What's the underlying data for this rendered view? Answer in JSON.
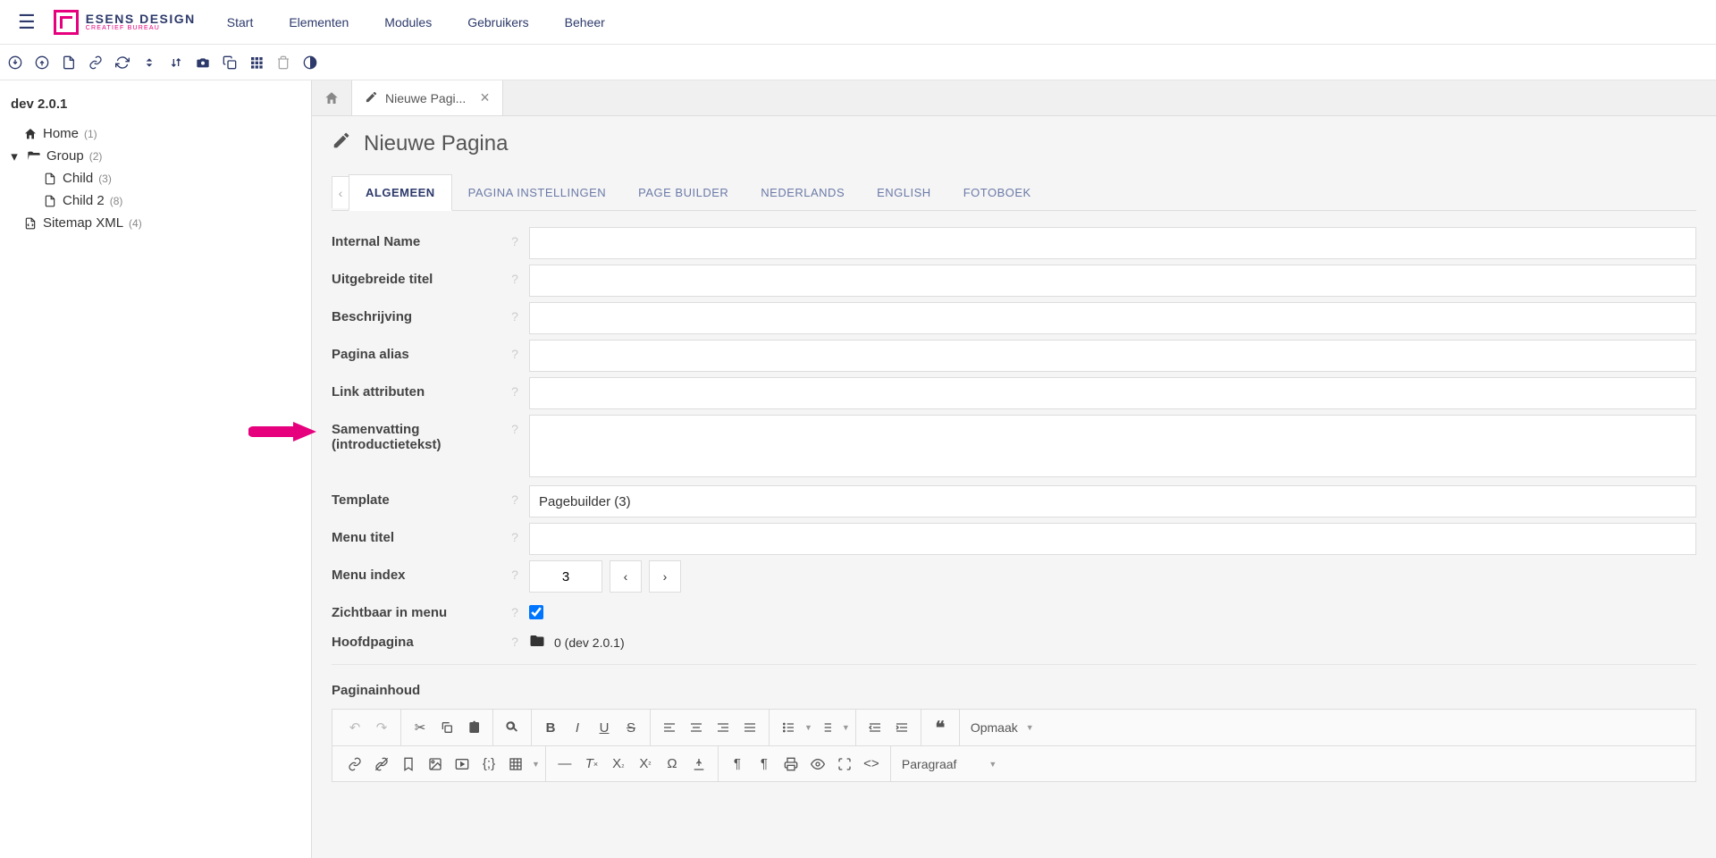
{
  "logo": {
    "title": "ESENS DESIGN",
    "subtitle": "CREATIEF BUREAU"
  },
  "topnav": [
    "Start",
    "Elementen",
    "Modules",
    "Gebruikers",
    "Beheer"
  ],
  "tree": {
    "root": "dev 2.0.1",
    "items": [
      {
        "label": "Home",
        "count": "(1)"
      },
      {
        "label": "Group",
        "count": "(2)",
        "children": [
          {
            "label": "Child",
            "count": "(3)"
          },
          {
            "label": "Child 2",
            "count": "(8)"
          }
        ]
      },
      {
        "label": "Sitemap XML",
        "count": "(4)"
      }
    ]
  },
  "tabs": {
    "active": "Nieuwe Pagi..."
  },
  "page": {
    "title": "Nieuwe Pagina"
  },
  "subtabs": [
    "ALGEMEEN",
    "PAGINA INSTELLINGEN",
    "PAGE BUILDER",
    "NEDERLANDS",
    "ENGLISH",
    "FOTOBOEK"
  ],
  "form": {
    "internal_name": {
      "label": "Internal Name",
      "value": ""
    },
    "uitgebreide_titel": {
      "label": "Uitgebreide titel",
      "value": ""
    },
    "beschrijving": {
      "label": "Beschrijving",
      "value": ""
    },
    "pagina_alias": {
      "label": "Pagina alias",
      "value": ""
    },
    "link_attributen": {
      "label": "Link attributen",
      "value": ""
    },
    "samenvatting": {
      "label": "Samenvatting (introductietekst)",
      "value": ""
    },
    "template": {
      "label": "Template",
      "value": "Pagebuilder (3)"
    },
    "menu_titel": {
      "label": "Menu titel",
      "value": ""
    },
    "menu_index": {
      "label": "Menu index",
      "value": "3"
    },
    "zichtbaar": {
      "label": "Zichtbaar in menu",
      "checked": true
    },
    "hoofdpagina": {
      "label": "Hoofdpagina",
      "value": "0 (dev 2.0.1)"
    }
  },
  "paginainhoud": {
    "label": "Paginainhoud"
  },
  "rte": {
    "opmaak": "Opmaak",
    "paragraaf": "Paragraaf"
  }
}
